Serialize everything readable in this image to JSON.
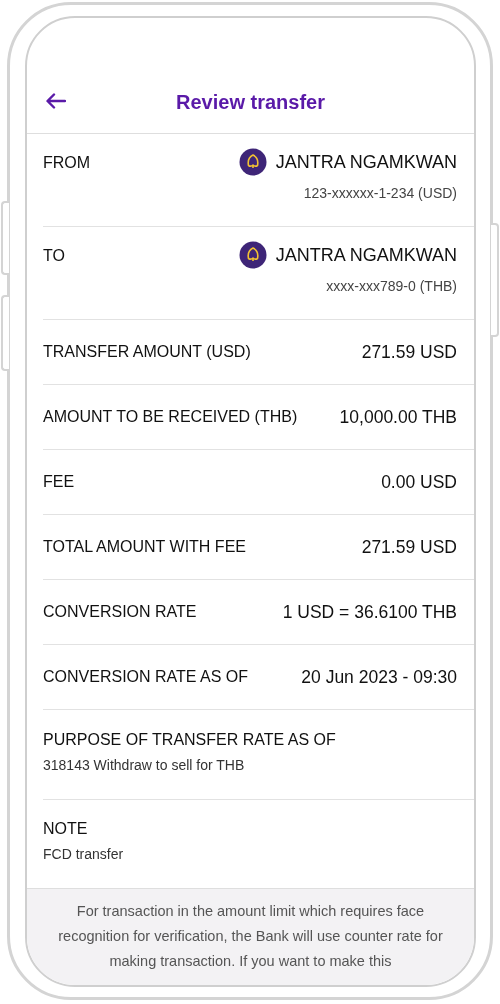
{
  "header": {
    "title": "Review transfer"
  },
  "rows": [
    {
      "kind": "account",
      "label": "FROM",
      "name": "JANTRA NGAMKWAN",
      "account": "123-xxxxxx-1-234 (USD)"
    },
    {
      "kind": "account",
      "label": "TO",
      "name": "JANTRA NGAMKWAN",
      "account": "xxxx-xxx789-0 (THB)"
    },
    {
      "kind": "pair",
      "label": "TRANSFER AMOUNT (USD)",
      "value": "271.59 USD"
    },
    {
      "kind": "pair",
      "label": "AMOUNT TO BE RECEIVED (THB)",
      "value": "10,000.00 THB"
    },
    {
      "kind": "pair",
      "label": "FEE",
      "value": "0.00 USD"
    },
    {
      "kind": "pair",
      "label": "TOTAL AMOUNT WITH FEE",
      "value": "271.59 USD"
    },
    {
      "kind": "pair",
      "label": "CONVERSION RATE",
      "value": "1 USD = 36.6100 THB"
    },
    {
      "kind": "pair",
      "label": "CONVERSION RATE AS OF",
      "value": "20 Jun 2023 - 09:30"
    },
    {
      "kind": "stacked",
      "label": "PURPOSE OF TRANSFER RATE AS OF",
      "value": "318143 Withdraw to sell for THB"
    },
    {
      "kind": "stacked",
      "label": "NOTE",
      "value": "FCD transfer"
    }
  ],
  "notice": "For transaction in the amount limit which requires face recognition for verification, the Bank will use counter rate for making transaction. If you want to make this"
}
